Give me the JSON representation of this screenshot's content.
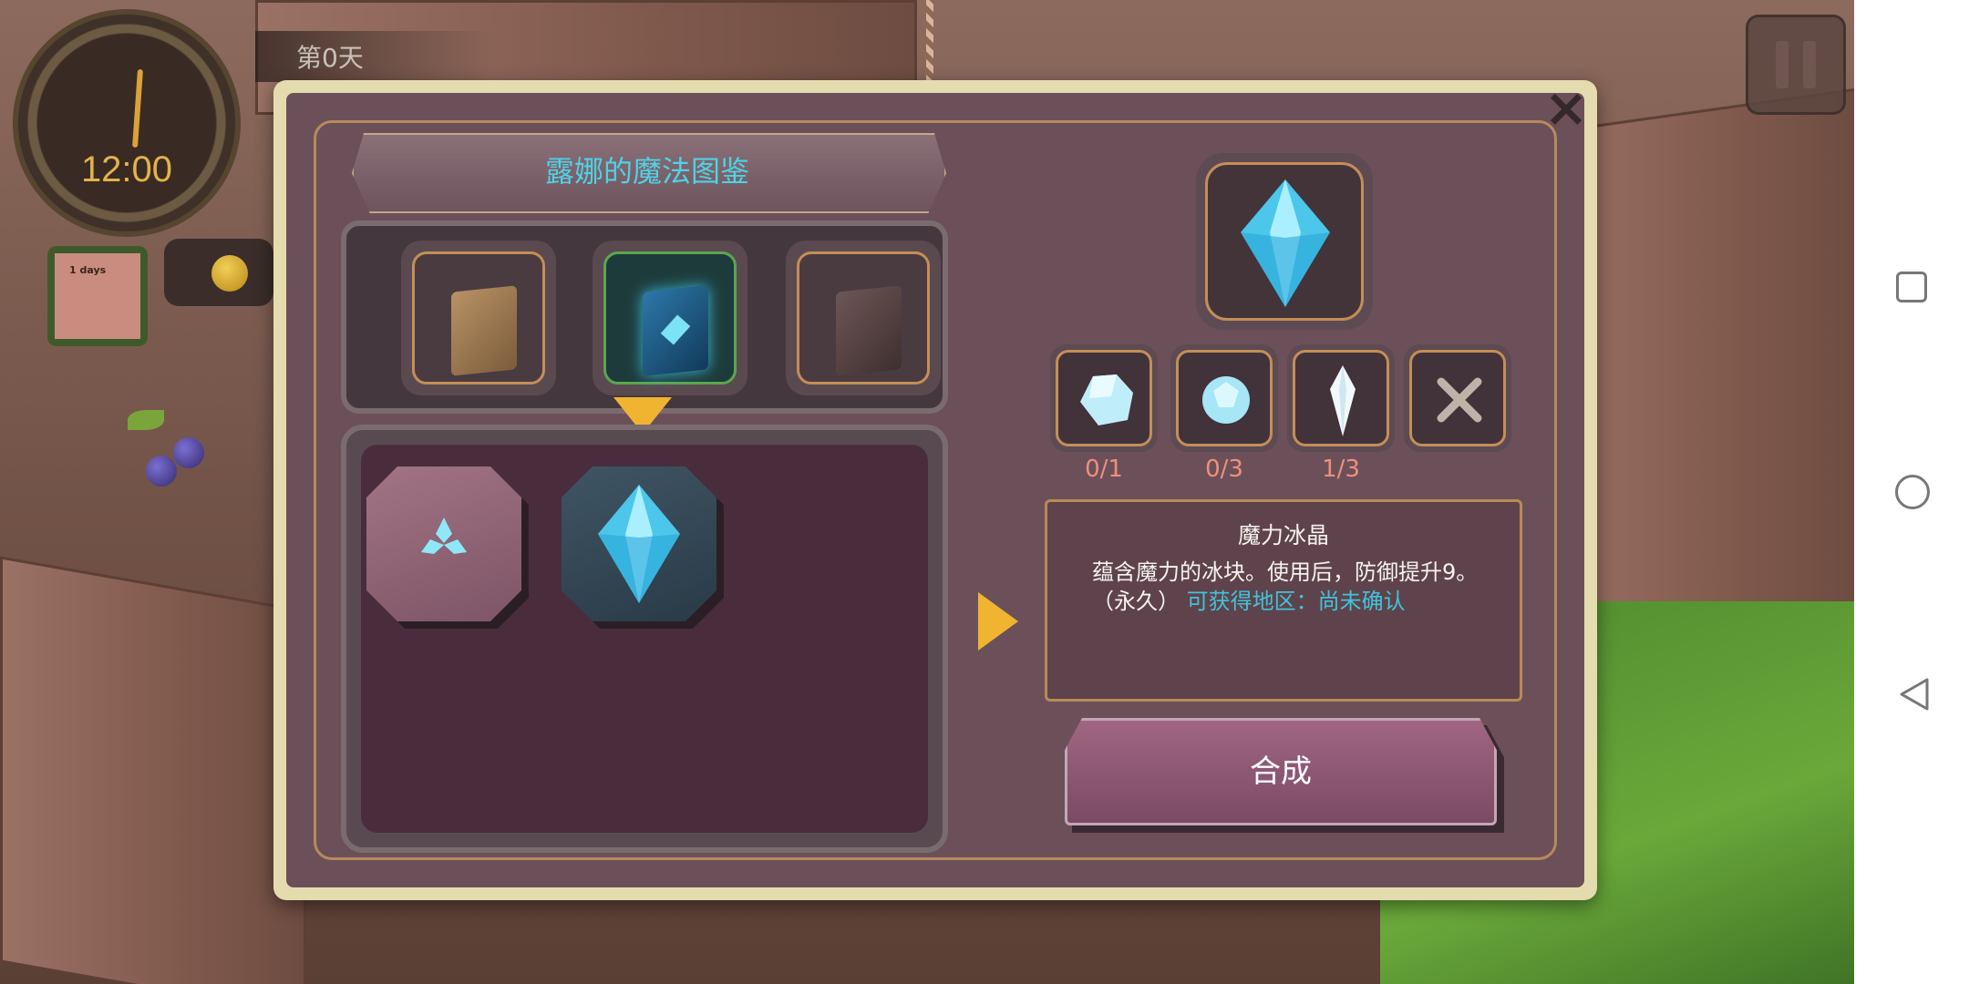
{
  "hud": {
    "day_label": "第0天",
    "clock_time": "12:00",
    "note_text": "1 days"
  },
  "dialog": {
    "title": "露娜的魔法图鉴",
    "close_symbol": "×",
    "books": [
      {
        "name": "book-brown",
        "selected": false
      },
      {
        "name": "book-blue-magic",
        "selected": true
      },
      {
        "name": "book-dark",
        "selected": false
      }
    ],
    "result_slots": [
      {
        "icon": "triforce-crystal-icon"
      },
      {
        "icon": "ice-crystal-icon"
      }
    ],
    "preview_icon": "ice-crystal-icon",
    "materials": [
      {
        "icon": "ice-chunk-icon",
        "count": "0/1"
      },
      {
        "icon": "ice-orb-icon",
        "count": "0/3"
      },
      {
        "icon": "crystal-shard-icon",
        "count": "1/3"
      },
      {
        "icon": "empty-slot-x-icon",
        "count": ""
      }
    ],
    "item": {
      "name": "魔力冰晶",
      "description": "蕴含魔力的冰块。使用后，防御提升9。（永久）",
      "source": "可获得地区：尚未确认"
    },
    "craft_button": "合成"
  },
  "colors": {
    "accent_title": "#4fd2e6",
    "material_count": "#ef8f7c",
    "indicator": "#f1b431",
    "highlight_text": "#41c3d9"
  }
}
